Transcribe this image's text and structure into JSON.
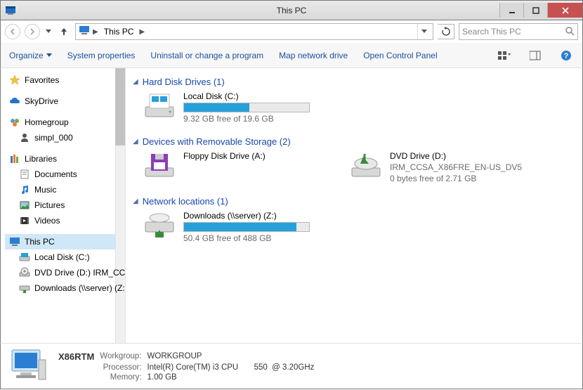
{
  "window": {
    "title": "This PC"
  },
  "breadcrumb": {
    "root": "This PC"
  },
  "search": {
    "placeholder": "Search This PC"
  },
  "toolbar": {
    "organize": "Organize",
    "system_properties": "System properties",
    "uninstall": "Uninstall or change a program",
    "map_drive": "Map network drive",
    "control_panel": "Open Control Panel"
  },
  "sidebar": {
    "favorites": "Favorites",
    "skydrive": "SkyDrive",
    "homegroup": "Homegroup",
    "homegroup_user": "simpl_000",
    "libraries": "Libraries",
    "lib_documents": "Documents",
    "lib_music": "Music",
    "lib_pictures": "Pictures",
    "lib_videos": "Videos",
    "this_pc": "This PC",
    "local_disk": "Local Disk (C:)",
    "dvd": "DVD Drive (D:) IRM_CCS",
    "downloads": "Downloads (\\\\server) (Z:"
  },
  "groups": {
    "hdd": "Hard Disk Drives (1)",
    "removable": "Devices with Removable Storage (2)",
    "network": "Network locations (1)"
  },
  "drives": {
    "c": {
      "name": "Local Disk (C:)",
      "free": "9.32 GB free of 19.6 GB",
      "fill_pct": 52
    },
    "floppy": {
      "name": "Floppy Disk Drive (A:)"
    },
    "dvd": {
      "name": "DVD Drive (D:)",
      "label": "IRM_CCSA_X86FRE_EN-US_DV5",
      "free": "0 bytes free of 2.71 GB"
    },
    "z": {
      "name": "Downloads (\\\\server) (Z:)",
      "free": "50.4 GB free of 488 GB",
      "fill_pct": 90
    }
  },
  "details": {
    "hostname": "X86RTM",
    "workgroup_label": "Workgroup:",
    "workgroup": "WORKGROUP",
    "processor_label": "Processor:",
    "processor": "Intel(R) Core(TM) i3 CPU       550  @ 3.20GHz",
    "memory_label": "Memory:",
    "memory": "1.00 GB"
  }
}
